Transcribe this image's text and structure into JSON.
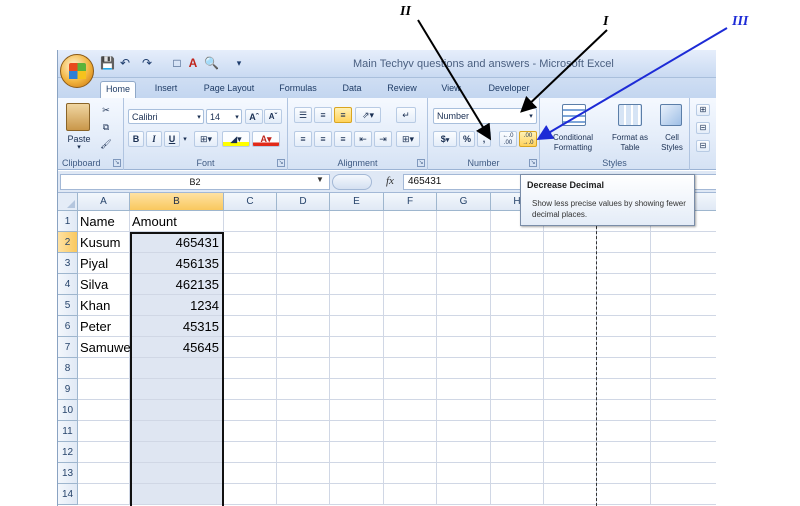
{
  "window": {
    "title": "Main Techyv questions and answers - Microsoft Excel"
  },
  "tabs": [
    "Home",
    "Insert",
    "Page Layout",
    "Formulas",
    "Data",
    "Review",
    "View",
    "Developer"
  ],
  "ribbon": {
    "clipboard": {
      "label": "Clipboard",
      "paste": "Paste"
    },
    "font": {
      "label": "Font",
      "name": "Calibri",
      "size": "14",
      "bold": "B",
      "italic": "I",
      "underline": "U"
    },
    "alignment": {
      "label": "Alignment"
    },
    "number": {
      "label": "Number",
      "format": "Number",
      "currency": "$",
      "percent": "%",
      "comma": ",",
      "inc_decimal": "+.0 .00",
      "dec_decimal": ".00 +.0"
    },
    "styles": {
      "label": "Styles",
      "conditional": "Conditional Formatting",
      "as_table": "Format as Table",
      "cell_styles": "Cell Styles"
    }
  },
  "formula_bar": {
    "name_box": "B2",
    "fx": "fx",
    "value": "465431"
  },
  "columns": [
    "A",
    "B",
    "C",
    "D",
    "E",
    "F",
    "G",
    "H"
  ],
  "rows": [
    {
      "num": "1",
      "a": "Name",
      "b": "Amount"
    },
    {
      "num": "2",
      "a": "Kusum",
      "b": "465431"
    },
    {
      "num": "3",
      "a": "Piyal",
      "b": "456135"
    },
    {
      "num": "4",
      "a": "Silva",
      "b": "462135"
    },
    {
      "num": "5",
      "a": "Khan",
      "b": "1234"
    },
    {
      "num": "6",
      "a": "Peter",
      "b": "45315"
    },
    {
      "num": "7",
      "a": "Samuwe",
      "b": "45645"
    },
    {
      "num": "8",
      "a": "",
      "b": ""
    },
    {
      "num": "9",
      "a": "",
      "b": ""
    },
    {
      "num": "10",
      "a": "",
      "b": ""
    },
    {
      "num": "11",
      "a": "",
      "b": ""
    },
    {
      "num": "12",
      "a": "",
      "b": ""
    },
    {
      "num": "13",
      "a": "",
      "b": ""
    },
    {
      "num": "14",
      "a": "",
      "b": ""
    }
  ],
  "tooltip": {
    "title": "Decrease Decimal",
    "body": "Show less precise values by showing fewer decimal places."
  },
  "annotations": [
    "I",
    "II",
    "III"
  ],
  "colors": {
    "annotation_black": "#000000",
    "annotation_blue": "#1d2bd6",
    "selection": "#f9c85e"
  }
}
